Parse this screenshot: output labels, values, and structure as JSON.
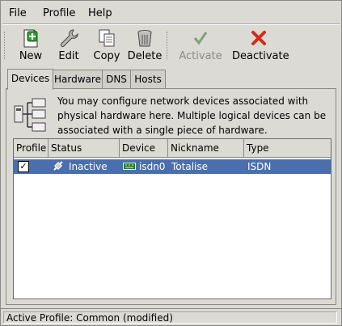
{
  "menubar": {
    "items": [
      {
        "label": "File"
      },
      {
        "label": "Profile"
      },
      {
        "label": "Help"
      }
    ]
  },
  "toolbar": {
    "new_label": "New",
    "edit_label": "Edit",
    "copy_label": "Copy",
    "delete_label": "Delete",
    "activate_label": "Activate",
    "deactivate_label": "Deactivate"
  },
  "tabs": [
    {
      "label": "Devices"
    },
    {
      "label": "Hardware"
    },
    {
      "label": "DNS"
    },
    {
      "label": "Hosts"
    }
  ],
  "info_text": "You may configure network devices associated with physical hardware here.  Multiple logical devices can be associated with a single piece of hardware.",
  "table": {
    "columns": [
      "Profile",
      "Status",
      "Device",
      "Nickname",
      "Type"
    ],
    "rows": [
      {
        "profile_checked": true,
        "status": "Inactive",
        "device": "isdn0",
        "nickname": "Totalise",
        "type": "ISDN"
      }
    ]
  },
  "statusbar": {
    "text": "Active Profile: Common (modified)"
  },
  "colors": {
    "selection": "#4b6fae",
    "background": "#dcdad5",
    "new_icon": "#2e9a2e",
    "deactivate_icon": "#d42a1a"
  }
}
